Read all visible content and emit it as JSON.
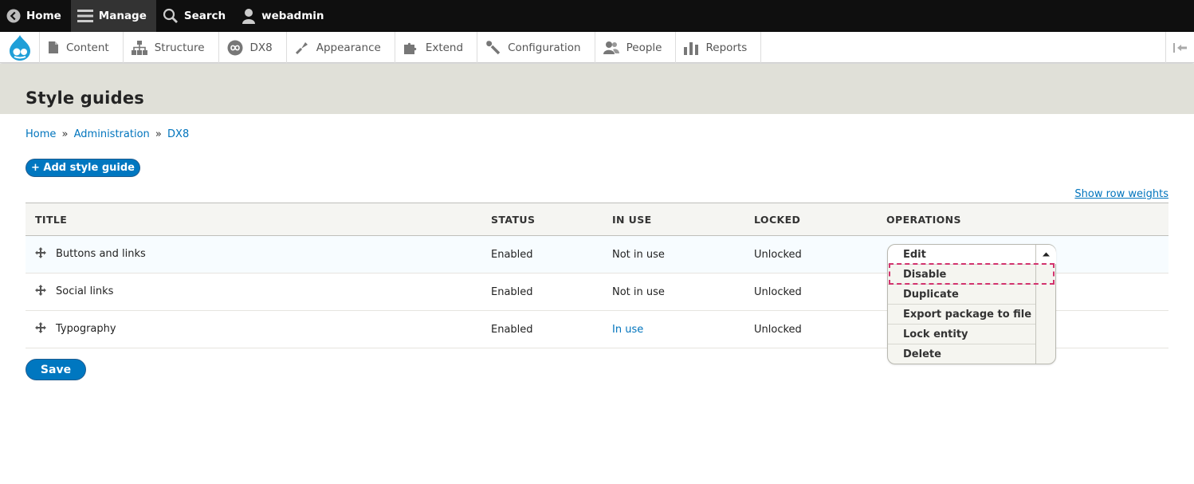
{
  "toolbar": {
    "home": "Home",
    "manage": "Manage",
    "search": "Search",
    "user": "webadmin"
  },
  "tray": {
    "items": [
      "Content",
      "Structure",
      "DX8",
      "Appearance",
      "Extend",
      "Configuration",
      "People",
      "Reports"
    ]
  },
  "page": {
    "title": "Style guides",
    "breadcrumb": [
      "Home",
      "Administration",
      "DX8"
    ],
    "breadcrumb_sep": "»",
    "add_button": "+ Add style guide",
    "row_weights": "Show row weights",
    "save_button": "Save"
  },
  "table": {
    "headers": [
      "TITLE",
      "STATUS",
      "IN USE",
      "LOCKED",
      "OPERATIONS"
    ],
    "rows": [
      {
        "title": "Buttons and links",
        "status": "Enabled",
        "in_use": "Not in use",
        "locked": "Unlocked"
      },
      {
        "title": "Social links",
        "status": "Enabled",
        "in_use": "Not in use",
        "locked": "Unlocked"
      },
      {
        "title": "Typography",
        "status": "Enabled",
        "in_use": "In use",
        "locked": "Unlocked"
      }
    ]
  },
  "operations": [
    "Edit",
    "Disable",
    "Duplicate",
    "Export package to file",
    "Lock entity",
    "Delete"
  ],
  "colors": {
    "link": "#0074bd",
    "primary_button": "#0077c0",
    "highlight": "#d2336e",
    "header_band": "#e0e0d8",
    "toolbar": "#0f0f0f"
  }
}
